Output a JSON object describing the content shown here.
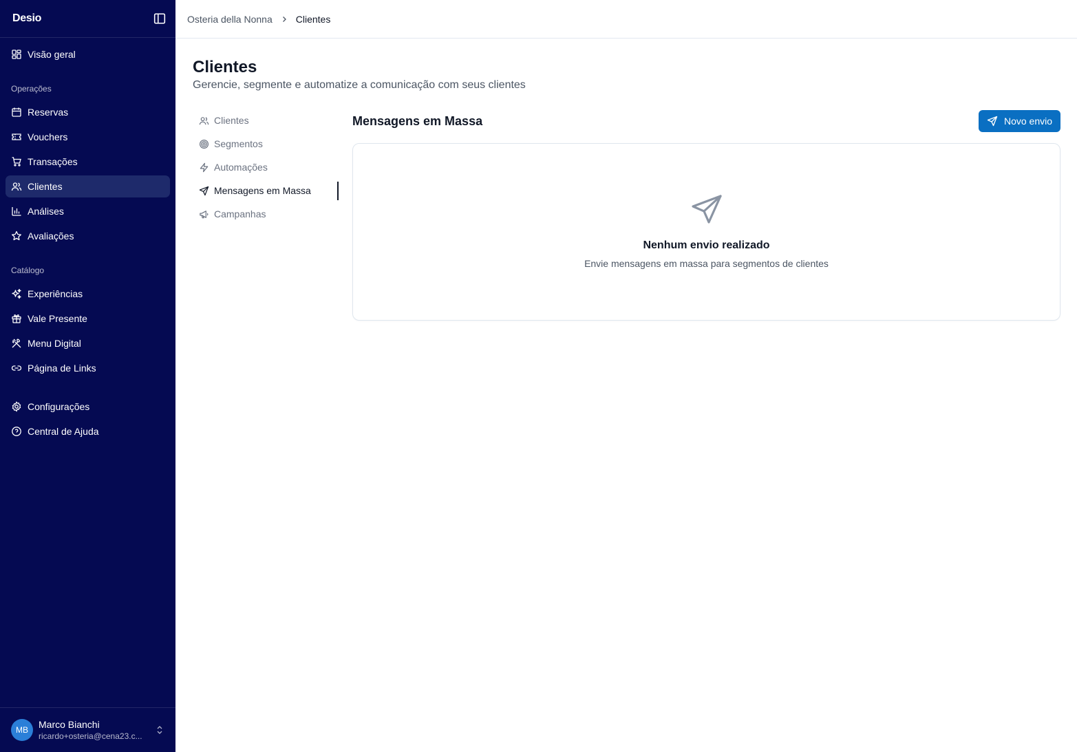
{
  "app": {
    "logo_text": "Desio"
  },
  "sidebar": {
    "top_item": {
      "label": "Visão geral",
      "icon": "layout-dashboard-icon"
    },
    "groups": [
      {
        "label": "Operações",
        "items": [
          {
            "label": "Reservas",
            "icon": "calendar-icon"
          },
          {
            "label": "Vouchers",
            "icon": "ticket-icon"
          },
          {
            "label": "Transações",
            "icon": "shopping-cart-icon"
          },
          {
            "label": "Clientes",
            "icon": "users-icon",
            "active": true
          },
          {
            "label": "Análises",
            "icon": "bar-chart-icon"
          },
          {
            "label": "Avaliações",
            "icon": "star-icon"
          }
        ]
      },
      {
        "label": "Catálogo",
        "items": [
          {
            "label": "Experiências",
            "icon": "sparkles-icon"
          },
          {
            "label": "Vale Presente",
            "icon": "gift-icon"
          },
          {
            "label": "Menu Digital",
            "icon": "utensils-icon"
          },
          {
            "label": "Página de Links",
            "icon": "link-icon"
          }
        ]
      }
    ],
    "bottom_items": [
      {
        "label": "Configurações",
        "icon": "settings-icon"
      },
      {
        "label": "Central de Ajuda",
        "icon": "help-circle-icon"
      }
    ],
    "user": {
      "initials": "MB",
      "name": "Marco Bianchi",
      "email": "ricardo+osteria@cena23.c..."
    }
  },
  "breadcrumb": {
    "parent": "Osteria della Nonna",
    "current": "Clientes"
  },
  "page": {
    "title": "Clientes",
    "subtitle": "Gerencie, segmente e automatize a comunicação com seus clientes"
  },
  "subnav": [
    {
      "label": "Clientes",
      "icon": "users-icon"
    },
    {
      "label": "Segmentos",
      "icon": "target-icon"
    },
    {
      "label": "Automações",
      "icon": "zap-icon"
    },
    {
      "label": "Mensagens em Massa",
      "icon": "send-icon",
      "active": true
    },
    {
      "label": "Campanhas",
      "icon": "megaphone-icon"
    }
  ],
  "section": {
    "title": "Mensagens em Massa",
    "action_label": "Novo envio"
  },
  "empty_state": {
    "title": "Nenhum envio realizado",
    "description": "Envie mensagens em massa para segmentos de clientes"
  },
  "colors": {
    "sidebar_bg": "#050a52",
    "sidebar_active": "#1e2a6b",
    "primary": "#0a6fc2",
    "avatar": "#2b7fd8"
  }
}
